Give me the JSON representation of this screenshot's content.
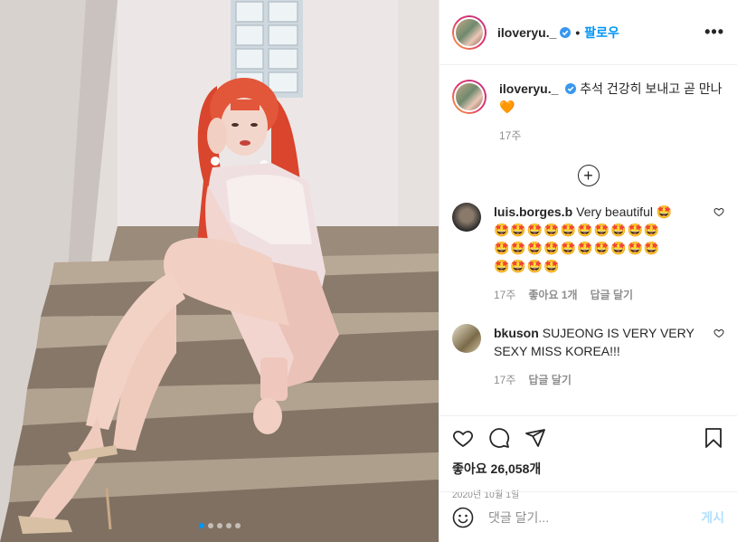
{
  "post": {
    "username": "iloveryu._",
    "follow_label": "팔로우",
    "separator": "•",
    "more_label": "•••"
  },
  "caption": {
    "username": "iloveryu._",
    "text": "추석 건강히 보내고 곧 만나",
    "emoji": "🧡",
    "time": "17주"
  },
  "comments": [
    {
      "username": "luis.borges.b",
      "text": "Very beautiful",
      "emoji_lines": [
        "🤩",
        "🤩🤩🤩🤩🤩🤩🤩🤩🤩🤩",
        "🤩🤩🤩🤩🤩🤩🤩🤩🤩🤩",
        "🤩🤩🤩🤩"
      ],
      "time": "17주",
      "likes": "좋아요 1개",
      "reply": "답글 달기"
    },
    {
      "username": "bkuson",
      "text": "SUJEONG IS VERY VERY SEXY MISS KOREA!!!",
      "time": "17주",
      "reply": "답글 달기"
    }
  ],
  "stats": {
    "likes": "좋아요 26,058개",
    "date": "2020년 10월 1일"
  },
  "comment_box": {
    "placeholder": "댓글 달기...",
    "post_label": "게시"
  },
  "carousel": {
    "count": 5,
    "active": 0
  },
  "colors": {
    "accent": "#0095f6",
    "verified": "#3897f0",
    "muted": "#8e8e8e",
    "post_disabled": "#b2dffc"
  },
  "icons": [
    "heart-icon",
    "comment-icon",
    "share-icon",
    "bookmark-icon",
    "emoji-icon",
    "add-circle-icon",
    "verified-icon",
    "more-icon"
  ]
}
